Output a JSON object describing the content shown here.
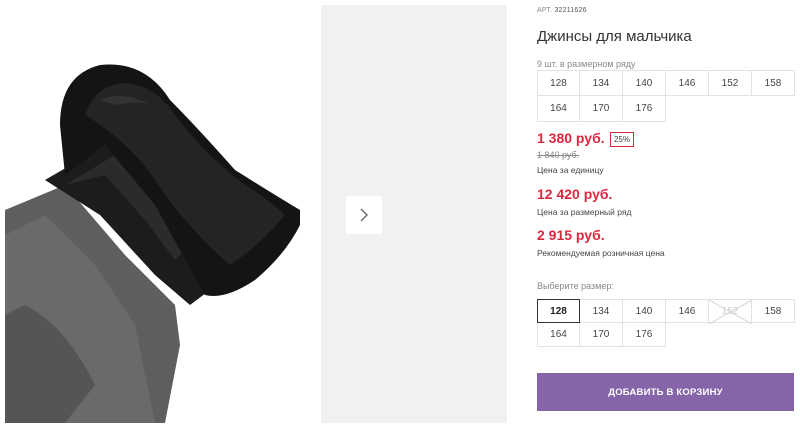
{
  "product": {
    "article_label": "АРТ.",
    "article_number": "32211626",
    "title": "Джинсы для мальчика"
  },
  "size_row": {
    "hint": "9 шт. в размерном ряду",
    "sizes": [
      "128",
      "134",
      "140",
      "146",
      "152",
      "158",
      "164",
      "170",
      "176"
    ]
  },
  "prices": {
    "unit_price": "1 380 руб.",
    "discount": "25%",
    "old_price": "1 840 руб.",
    "unit_label": "Цена за единицу",
    "row_price": "12 420 руб.",
    "row_label": "Цена за размерный ряд",
    "retail_price": "2 915 руб.",
    "retail_label": "Рекомендуемая розничная цена"
  },
  "size_select": {
    "hint": "Выберите размер:",
    "sizes": [
      "128",
      "134",
      "140",
      "146",
      "152",
      "158",
      "164",
      "170",
      "176"
    ],
    "selected": "128",
    "unavailable": "152"
  },
  "cart": {
    "button_label": "ДОБАВИТЬ В КОРЗИНУ"
  },
  "colors": {
    "accent": "#8664a8",
    "price": "#e0263e"
  },
  "icons": {
    "next": "chevron-right-icon",
    "unavailable": "cross-out-icon"
  }
}
